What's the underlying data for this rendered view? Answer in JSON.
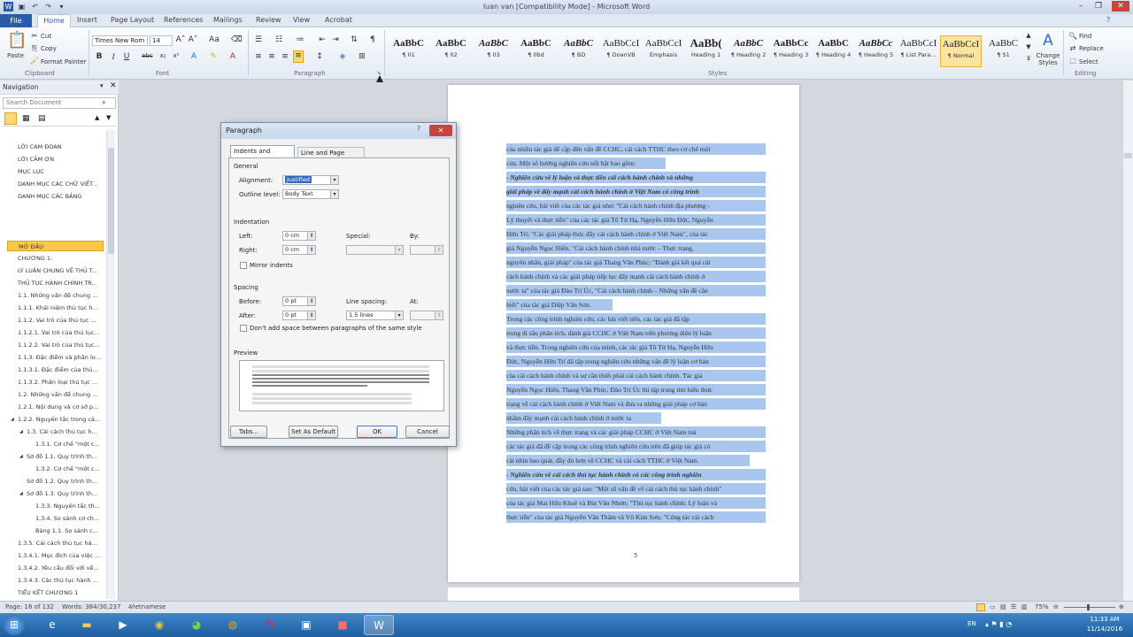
{
  "window": {
    "title": "luan van [Compatibility Mode] - Microsoft Word"
  },
  "tabs": [
    "File",
    "Home",
    "Insert",
    "Page Layout",
    "References",
    "Mailings",
    "Review",
    "View",
    "Acrobat"
  ],
  "clipboard": {
    "paste": "Paste",
    "cut": "Cut",
    "copy": "Copy",
    "format_painter": "Format Painter",
    "label": "Clipboard"
  },
  "font": {
    "name": "Times New Rom",
    "size": "14",
    "label": "Font"
  },
  "paragraph_label": "Paragraph",
  "styles": [
    {
      "preview": "AaBbC",
      "name": "¶ 01"
    },
    {
      "preview": "AaBbC",
      "name": "¶ 02"
    },
    {
      "preview": "AaBbC",
      "name": "¶ 03"
    },
    {
      "preview": "AaBbC",
      "name": "¶ 0bd"
    },
    {
      "preview": "AaBbC",
      "name": "¶ BD"
    },
    {
      "preview": "AaBbCcI",
      "name": "¶ DoanVB"
    },
    {
      "preview": "AaBbCcI",
      "name": "Emphasis"
    },
    {
      "preview": "AaBb(",
      "name": "Heading 1"
    },
    {
      "preview": "AaBbC",
      "name": "¶ Heading 2"
    },
    {
      "preview": "AaBbCc",
      "name": "¶ Heading 3"
    },
    {
      "preview": "AaBbC",
      "name": "¶ Heading 4"
    },
    {
      "preview": "AaBbCc",
      "name": "¶ Heading 5"
    },
    {
      "preview": "AaBbCcI",
      "name": "¶ List Para..."
    },
    {
      "preview": "AaBbCcI",
      "name": "¶ Normal"
    },
    {
      "preview": "AaBbC",
      "name": "¶ S1"
    }
  ],
  "styles_label": "Styles",
  "change_styles": "Change Styles",
  "editing": {
    "find": "Find",
    "replace": "Replace",
    "select": "Select",
    "label": "Editing"
  },
  "nav": {
    "title": "Navigation",
    "search_placeholder": "Search Document",
    "items": [
      "LỜI CAM ĐOAN",
      "LỜI CẢM ƠN",
      "MỤC LỤC",
      "DANH MỤC CÁC CHỮ VIẾT...",
      "DANH MỤC CÁC BẢNG",
      "MỞ ĐẦU",
      "CHƯƠNG 1:",
      "LÝ LUẬN CHUNG VỀ THỦ T...",
      "THỦ TỤC HÀNH CHÍNH TR...",
      "1.1. Những vấn đề chung ...",
      "1.1.1.  Khái niệm thủ tục h...",
      "1.1.2. Vai trò của thủ tục ...",
      "1.1.2.1. Vai trò của thủ tục...",
      "1.1.2.2. Vai trò của thủ tục...",
      "1.1.3. Đặc điểm và phân lo...",
      "1.1.3.1. Đặc điểm của thủ...",
      "1.1.3.2. Phân loại thủ tục ...",
      "1.2. Những vấn đề chung ...",
      "1.2.1. Nội dung và cơ sở p...",
      "1.2.2. Nguyên tắc trong cả...",
      "1.3. Cải cách thủ tục h...",
      "1.3.1. Cơ chế \"một c...",
      "Sơ đồ 1.1. Quy trình th...",
      "1.3.2. Cơ chế \"một c...",
      "Sơ đồ 1.2. Quy trình th...",
      "Sơ đồ 1.3. Quy trình th...",
      "1.3.3. Nguyên tắc th...",
      "1.3.4. So sánh cơ ch...",
      "Bảng 1.1. So sánh c...",
      "1.3.5. Cải cách thủ tục hà...",
      "1.3.4.1. Mục đích của việc ...",
      "1.3.4.2. Yêu cầu đối với vế...",
      "1.3.4.3. Các thủ tục hành ...",
      "TIỂU KẾT CHƯƠNG 1"
    ]
  },
  "dialog": {
    "title": "Paragraph",
    "tab1": "Indents and Spacing",
    "tab2": "Line and Page Breaks",
    "general": "General",
    "alignment_label": "Alignment:",
    "alignment_value": "Justified",
    "outline_label": "Outline level:",
    "outline_value": "Body Text",
    "indentation": "Indentation",
    "left_label": "Left:",
    "left_value": "0 cm",
    "right_label": "Right:",
    "right_value": "0 cm",
    "special_label": "Special:",
    "by_label": "By:",
    "mirror": "Mirror indents",
    "spacing": "Spacing",
    "before_label": "Before:",
    "before_value": "0 pt",
    "after_label": "After:",
    "after_value": "0 pt",
    "line_spacing_label": "Line spacing:",
    "line_spacing_value": "1.5 lines",
    "at_label": "At:",
    "dont_add": "Don't add space between paragraphs of the same style",
    "preview": "Preview",
    "tabs_btn": "Tabs...",
    "default_btn": "Set As Default",
    "ok_btn": "OK",
    "cancel_btn": "Cancel"
  },
  "doc_lines": [
    "của nhiều tác giả để cập đến vấn đề CCHC, cải cách TTHC theo cơ chế một",
    "cửa. Một số hướng nghiên cứu nổi bật bao gồm:",
    "  - Nghiên cứu  về lý luận và thực tiễn cải cách hành chính và những",
    "giải pháp về đẩy mạnh cải cách hành chính ở Việt Nam có công trình",
    "nghiên cứu, bài viết của các tác giả như: \"Cải cách hành chính địa phương -",
    "Lý thuyết và thực tiễn\" của các tác giả Tô Tử Hạ, Nguyễn Hữu Đức, Nguyễn",
    "Hữu Trí; \"Các giải pháp thúc đẩy cải cách hành chính ở Việt Nam\", của tác",
    "giả Nguyễn Ngọc Hiến, \"Cải cách hành chính nhà nước – Thực trạng,",
    "nguyên nhân, giải pháp\" của tác giả Thang Văn Phúc; \"Đánh giá kết quả cải",
    "cách hành chính và các giải pháp tiếp tục đẩy mạnh cải cách hành chính ở",
    "nước ta\" của tác giả Đào Trí Úc, \"Cải cách hành chính – Những vấn đề cần",
    "biết\" của tác giả Diệp Văn Sơn.",
    "       Trong các công trình nghiên cứu, các bài viết trên, các tác giả đã tập",
    "trung đi sâu phân tích, đánh giá CCHC ở Việt Nam trên phương diện lý luận",
    "và thực tiễn. Trong nghiên cứu của mình, các tác giả Tô Tử Hạ, Nguyễn Hữu",
    "Đức, Nguyễn Hữu Trí đã tập trung nghiên cứu những vấn đề lý luận cơ bản",
    "của cải cách hành chính và sự cần thiết phải cải cách hành chính. Tác giả",
    "Nguyễn Ngọc Hiến, Thang Văn Phúc, Đào Trí Úc thì tập trung tìm hiểu thực",
    "trạng về cải cách hành chính ở Việt Nam và đưa ra những giải pháp cơ bản",
    "nhằm đẩy mạnh cải cách hành chính ở nước ta",
    "       Những phân tích về thực trạng và các giải pháp CCHC ở Việt Nam mà",
    "các tác giả đã đề cập trong các công trình nghiên cứu trên đã giúp tác giả có",
    "cái nhìn bao quát, đầy đủ hơn về CCHC và cải cách TTHC ở Việt Nam.",
    "  - Nghiên cứu về cải cách thủ tục hành chính có các công trình nghiên",
    "cứu, bài viết của các tác giả sau: \"Một số vấn đề về cải cách thủ tục hành chính\"",
    "của tác giả Mai Hữu Khuê và Bùi Văn Nhơn; \"Thủ tục hành chính: Lý luận và",
    "thực tiễn\" của tác giả Nguyễn Văn Thâm và Võ Kim Sơn; \"Công tác cải cách"
  ],
  "page_number": "5",
  "status": {
    "page": "Page: 16 of 132",
    "words": "Words: 384/30,237",
    "lang": "Vietnamese",
    "zoom": "75%"
  },
  "taskbar": {
    "lang": "EN",
    "time": "11:33 AM",
    "date": "11/14/2016"
  }
}
